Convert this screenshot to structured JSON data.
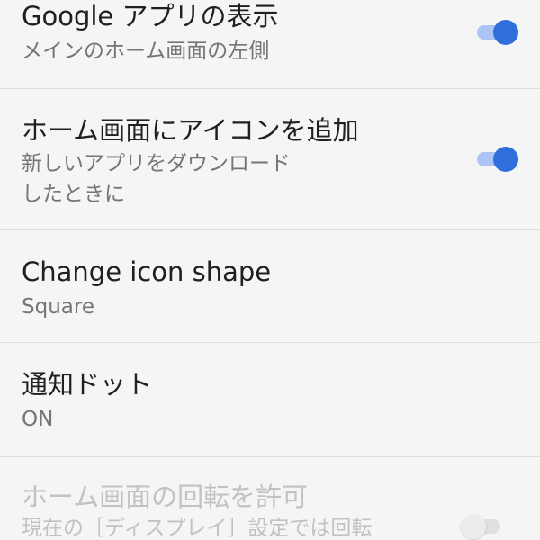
{
  "settings": {
    "items": [
      {
        "title": "Google アプリの表示",
        "summary": "メインのホーム画面の左側",
        "toggle": "on"
      },
      {
        "title": "ホーム画面にアイコンを追加",
        "summary_line1": "新しいアプリをダウンロード",
        "summary_line2": "したときに",
        "toggle": "on"
      },
      {
        "title": "Change icon shape",
        "summary": "Square"
      },
      {
        "title": "通知ドット",
        "summary": "ON"
      },
      {
        "title": "ホーム画面の回転を許可",
        "summary": "現在の［ディスプレイ］設定では回転",
        "toggle": "off",
        "state": "disabled"
      }
    ]
  },
  "colors": {
    "accent": "#2f6fdc",
    "accent_track": "#a9c4f5",
    "background": "#f5f5f5",
    "divider": "#dcdcdc"
  }
}
